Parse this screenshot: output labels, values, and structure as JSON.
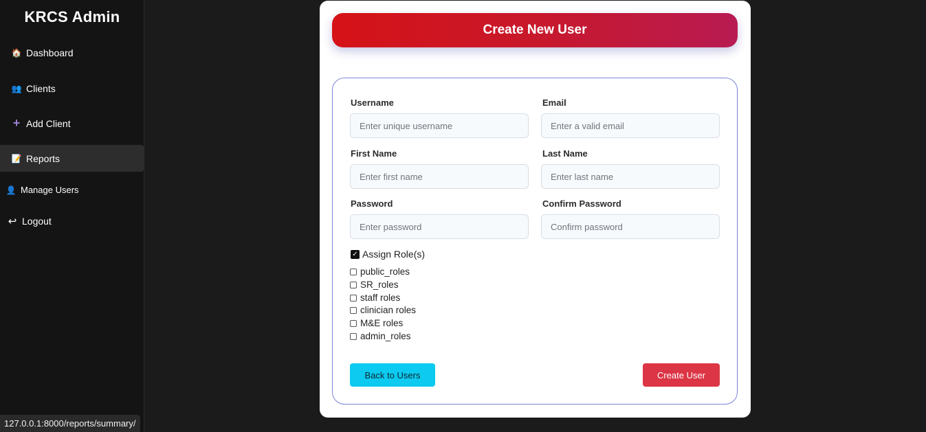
{
  "sidebar": {
    "brand": "KRCS Admin",
    "items": [
      {
        "icon": "house-icon",
        "glyph": "🏠",
        "label": "Dashboard"
      },
      {
        "icon": "people-icon",
        "glyph": "👥",
        "label": "Clients"
      },
      {
        "icon": "plus-icon",
        "glyph": "+",
        "label": "Add Client"
      },
      {
        "icon": "report-icon",
        "glyph": "📝",
        "label": "Reports"
      },
      {
        "icon": "user-icon",
        "glyph": "👤",
        "label": "Manage Users"
      },
      {
        "icon": "logout-arrow-icon",
        "glyph": "↩",
        "label": "Logout"
      }
    ],
    "active_item": "Reports"
  },
  "status_bar": {
    "url": "127.0.0.1:8000/reports/summary/"
  },
  "form": {
    "title": "Create New User",
    "username": {
      "label": "Username",
      "placeholder": "Enter unique username",
      "value": ""
    },
    "email": {
      "label": "Email",
      "placeholder": "Enter a valid email",
      "value": ""
    },
    "first_name": {
      "label": "First Name",
      "placeholder": "Enter first name",
      "value": ""
    },
    "last_name": {
      "label": "Last Name",
      "placeholder": "Enter last name",
      "value": ""
    },
    "password": {
      "label": "Password",
      "placeholder": "Enter password",
      "value": ""
    },
    "confirm_password": {
      "label": "Confirm Password",
      "placeholder": "Confirm password",
      "value": ""
    },
    "assign_roles": {
      "label": "Assign Role(s)",
      "checked": true
    },
    "roles": [
      {
        "label": "public_roles",
        "checked": false
      },
      {
        "label": "SR_roles",
        "checked": false
      },
      {
        "label": "staff roles",
        "checked": false
      },
      {
        "label": "clinician roles",
        "checked": false
      },
      {
        "label": "M&E roles",
        "checked": false
      },
      {
        "label": "admin_roles",
        "checked": false
      }
    ],
    "back_button": "Back to Users",
    "create_button": "Create User"
  },
  "colors": {
    "banner_start": "#d51217",
    "banner_end": "#b81b52",
    "back_button": "#0dcaf0",
    "create_button": "#dc3545",
    "form_border": "#7b84d6"
  }
}
